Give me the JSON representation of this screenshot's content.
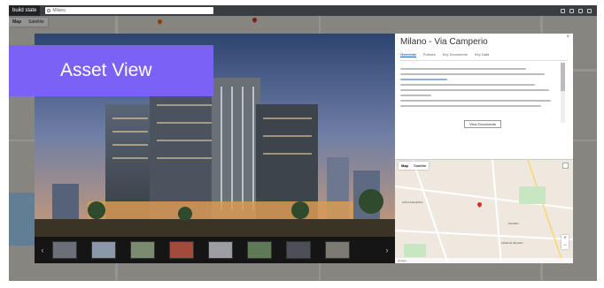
{
  "app": {
    "brand": "build state",
    "search_text": "Milano"
  },
  "map": {
    "type_buttons": [
      "Map",
      "Satellite"
    ]
  },
  "banner": {
    "label": "Asset View"
  },
  "asset": {
    "title": "Milano - Via Camperio",
    "close_glyph": "×",
    "tabs": [
      "Overview",
      "Policies",
      "Key Documents",
      "Key Data"
    ],
    "view_docs_label": "View Documents"
  },
  "gallery": {
    "prev_glyph": "‹",
    "next_glyph": "›",
    "thumb_count": 8
  },
  "minimap": {
    "type_buttons": [
      "Map",
      "Satellite"
    ],
    "zoom_in": "+",
    "zoom_out": "−",
    "provider": "Google",
    "district_labels": [
      "ZONA MAGENTA",
      "DUOMO",
      "ZONE DI MILANO"
    ]
  },
  "colors": {
    "accent": "#7b61f5",
    "tab_active": "#1f5fbf",
    "pin": "#d93025"
  }
}
